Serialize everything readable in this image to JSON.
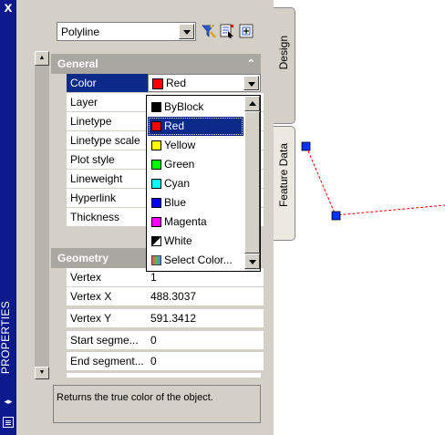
{
  "window": {
    "title": "PROPERTIES",
    "close_label": "x"
  },
  "selector": {
    "value": "Polyline"
  },
  "toolbar": {
    "icons": [
      "quick-select-icon",
      "select-objects-icon",
      "pickadd-icon"
    ]
  },
  "categories": {
    "general": "General",
    "geometry": "Geometry"
  },
  "general_rows": [
    {
      "name": "Color",
      "value": "Red"
    },
    {
      "name": "Layer",
      "value": ""
    },
    {
      "name": "Linetype",
      "value": ""
    },
    {
      "name": "Linetype scale",
      "value": ""
    },
    {
      "name": "Plot style",
      "value": ""
    },
    {
      "name": "Lineweight",
      "value": ""
    },
    {
      "name": "Hyperlink",
      "value": ""
    },
    {
      "name": "Thickness",
      "value": ""
    }
  ],
  "geometry_rows": [
    {
      "name": "Vertex",
      "value": "1"
    },
    {
      "name": "Vertex X",
      "value": "488.3037"
    },
    {
      "name": "Vertex Y",
      "value": "591.3412"
    },
    {
      "name": "Start segme...",
      "value": "0"
    },
    {
      "name": "End segment...",
      "value": "0"
    }
  ],
  "color_field": {
    "value": "Red",
    "swatch": "#ff0000"
  },
  "color_options": [
    {
      "label": "ByBlock",
      "color": "#000000"
    },
    {
      "label": "Red",
      "color": "#ff0000",
      "selected": true
    },
    {
      "label": "Yellow",
      "color": "#ffff00"
    },
    {
      "label": "Green",
      "color": "#00ff00"
    },
    {
      "label": "Cyan",
      "color": "#00ffff"
    },
    {
      "label": "Blue",
      "color": "#0000ff"
    },
    {
      "label": "Magenta",
      "color": "#ff00ff"
    },
    {
      "label": "White",
      "color": "#ffffff"
    },
    {
      "label": "Select Color...",
      "color": "#6aa0c8"
    }
  ],
  "description": "Returns the true color of the object.",
  "tabs": {
    "design": "Design",
    "feature_data": "Feature Data"
  },
  "colors": {
    "title_strip": "#0c1a8e",
    "selection": "#0b2a8a",
    "panel": "#d4d0c8",
    "grip": "#0033ff",
    "polyline": "#ff0000"
  }
}
